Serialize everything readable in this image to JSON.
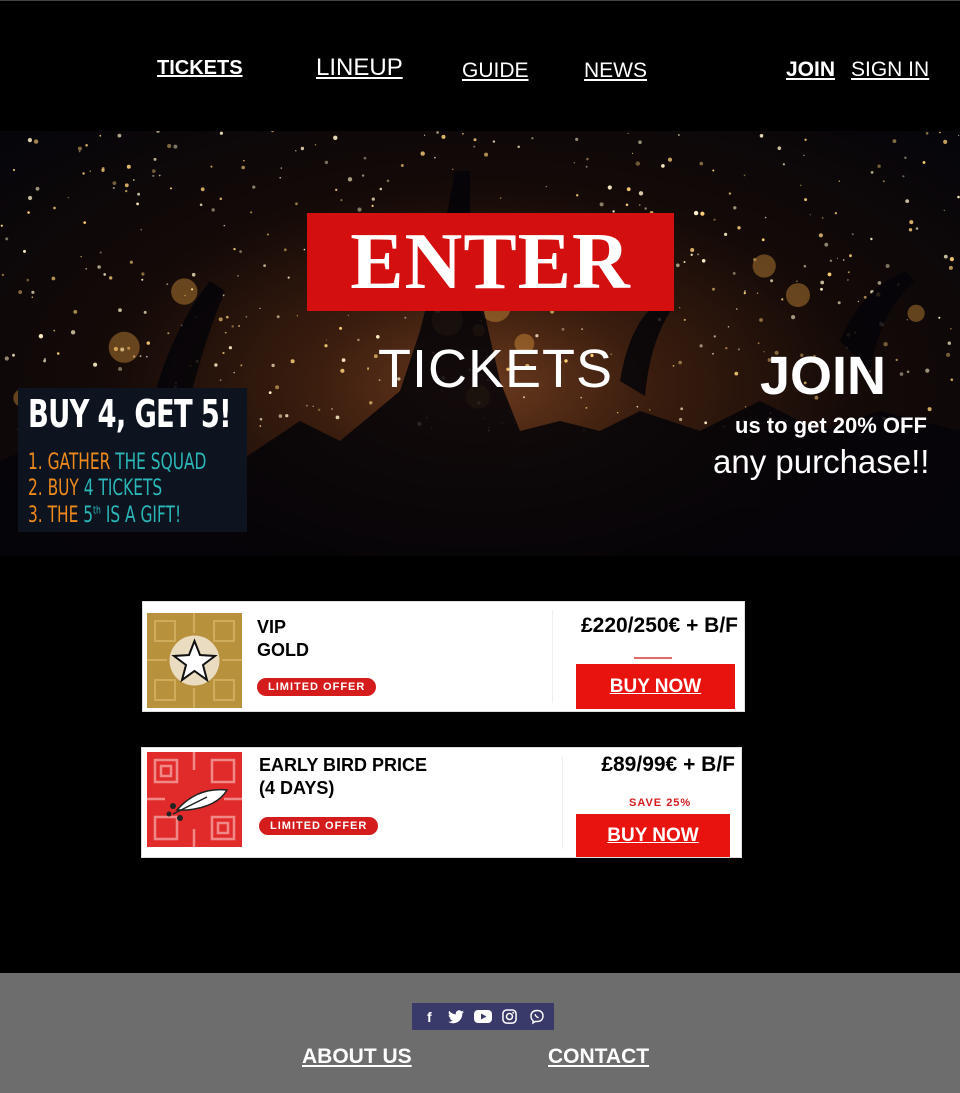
{
  "nav": {
    "tickets": "TICKETS",
    "lineup": "LINEUP",
    "guide": "GUIDE",
    "news": "NEWS",
    "join": "JOIN",
    "sign_in": "SIGN IN"
  },
  "hero": {
    "logo_text": "ENTER",
    "subtitle": "TICKETS",
    "join_title": "JOIN",
    "join_line1": "us to get 20% OFF",
    "join_line2": "any purchase!!",
    "promo": {
      "title": "BUY 4, GET 5!",
      "step1_num": "1.",
      "step1_a": "GATHER",
      "step1_b": "THE SQUAD",
      "step2_num": "2.",
      "step2_a": "BUY",
      "step2_b": "4 TICKETS",
      "step3_num": "3.",
      "step3_a": "THE",
      "step3_b": "5",
      "step3_sup": "th",
      "step3_c": "IS A GIFT!"
    }
  },
  "tickets": [
    {
      "title_line1": "VIP",
      "title_line2": "GOLD",
      "badge": "LIMITED OFFER",
      "price": "£220/250€ + B/F",
      "save": "",
      "button": "BUY NOW",
      "thumb_color": "#b8913d",
      "thumb_icon": "star-icon"
    },
    {
      "title_line1": "EARLY BIRD PRICE",
      "title_line2": "(4 DAYS)",
      "badge": "LIMITED OFFER",
      "price": "£89/99€ + B/F",
      "save": "SAVE 25%",
      "button": "BUY NOW",
      "thumb_color": "#e12a2a",
      "thumb_icon": "feather-icon"
    }
  ],
  "footer": {
    "social_icons": [
      "facebook-icon",
      "twitter-icon",
      "youtube-icon",
      "instagram-icon",
      "viber-icon"
    ],
    "facebook": "f",
    "about": "ABOUT US",
    "contact": "CONTACT"
  },
  "colors": {
    "accent_red": "#e8130f",
    "logo_red": "#d40f0f",
    "footer_bg": "#6d6d6d",
    "social_bg": "#3a3a6a",
    "promo_orange": "#f08a1d",
    "promo_teal": "#2bb7b8"
  }
}
